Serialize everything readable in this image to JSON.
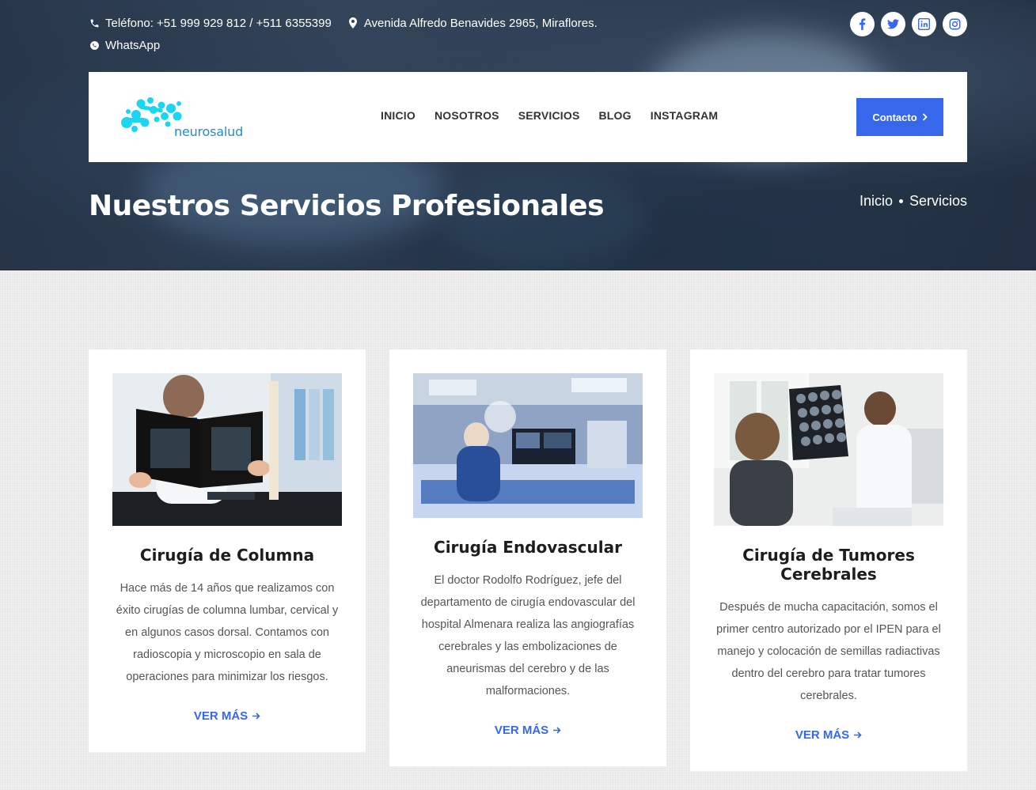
{
  "topbar": {
    "phone": "Teléfono: +51 999 929 812 / +511 6355399",
    "address": "Avenida Alfredo Benavides 2965, Miraflores.",
    "whatsapp": "WhatsApp"
  },
  "social": [
    {
      "icon": "facebook-icon",
      "glyph": "f"
    },
    {
      "icon": "twitter-icon",
      "glyph": "t"
    },
    {
      "icon": "linkedin-icon",
      "glyph": "in"
    },
    {
      "icon": "instagram-icon",
      "glyph": "◎"
    }
  ],
  "brand": {
    "name": "neurosalud",
    "accent": "#1ad6f2"
  },
  "nav": {
    "items": [
      "INICIO",
      "NOSOTROS",
      "SERVICIOS",
      "BLOG",
      "INSTAGRAM"
    ],
    "cta": "Contacto"
  },
  "hero": {
    "title": "Nuestros Servicios Profesionales",
    "breadcrumb": [
      "Inicio",
      "Servicios"
    ]
  },
  "services": [
    {
      "title": "Cirugía de Columna",
      "text": "Hace más de 14 años que realizamos con éxito cirugías de columna lumbar, cervical y en algunos casos dorsal. Contamos con radioscopia y microscopio en sala de operaciones para minimizar los riesgos.",
      "link": "VER MÁS"
    },
    {
      "title": "Cirugía Endovascular",
      "text": "El doctor Rodolfo Rodríguez, jefe del departamento de cirugía endovascular del hospital Almenara realiza las angiografías cerebrales y las embolizaciones de aneurismas del cerebro y de las malformaciones.",
      "link": "VER MÁS"
    },
    {
      "title": "Cirugía de Tumores Cerebrales",
      "text": "Después de mucha capacitación, somos el primer centro autorizado por el IPEN para el manejo y colocación de semillas radiactivas dentro del cerebro para tratar tumores cerebrales.",
      "link": "VER MÁS"
    }
  ],
  "colors": {
    "accent": "#3768ec",
    "brand": "#1ad6f2"
  }
}
